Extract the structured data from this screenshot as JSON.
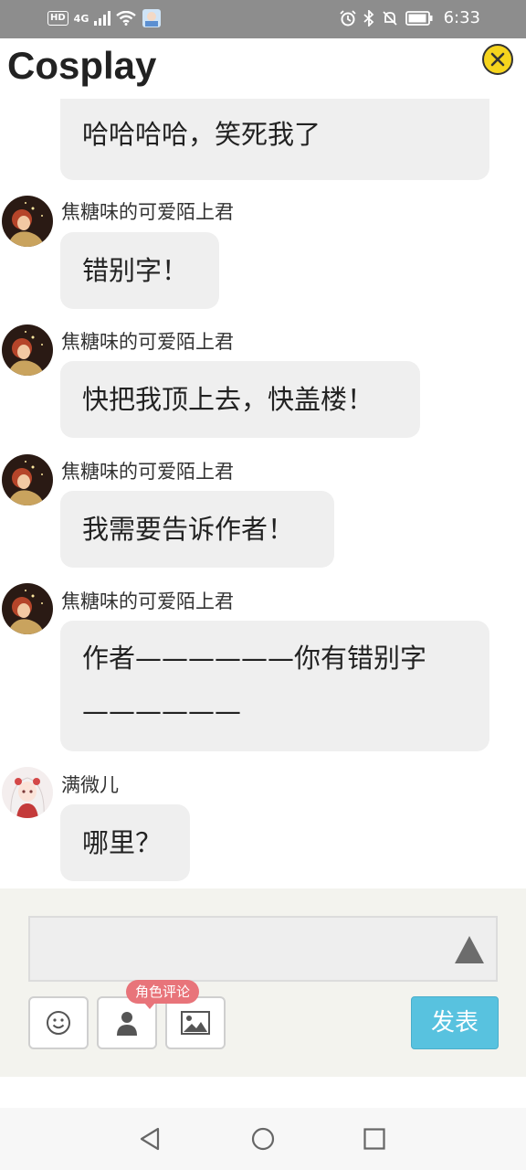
{
  "status_bar": {
    "hd": "HD",
    "network": "4G",
    "time": "6:33"
  },
  "header": {
    "title": "Cosplay"
  },
  "messages": [
    {
      "user": "",
      "text": "哈哈哈哈，笑死我了",
      "avatar": "avatar-caramel-icon"
    },
    {
      "user": "焦糖味的可爱陌上君",
      "text": "错别字！",
      "avatar": "avatar-caramel-icon"
    },
    {
      "user": "焦糖味的可爱陌上君",
      "text": "快把我顶上去，快盖楼！",
      "avatar": "avatar-caramel-icon"
    },
    {
      "user": "焦糖味的可爱陌上君",
      "text": "我需要告诉作者！",
      "avatar": "avatar-caramel-icon"
    },
    {
      "user": "焦糖味的可爱陌上君",
      "text_line1": "作者——————你有错别字",
      "text_line2": "——————",
      "avatar": "avatar-caramel-icon"
    },
    {
      "user": "满微儿",
      "text": "哪里？",
      "avatar": "avatar-anime-girl-icon"
    }
  ],
  "composer": {
    "input_value": "",
    "role_comment_tooltip": "角色评论",
    "publish_label": "发表"
  },
  "colors": {
    "status_bar": "#8d8d8d",
    "bubble": "#efefef",
    "composer_bg": "#f3f3ee",
    "publish_button": "#58c2df",
    "tooltip": "#e8747a",
    "close_button": "#f6d41d"
  }
}
